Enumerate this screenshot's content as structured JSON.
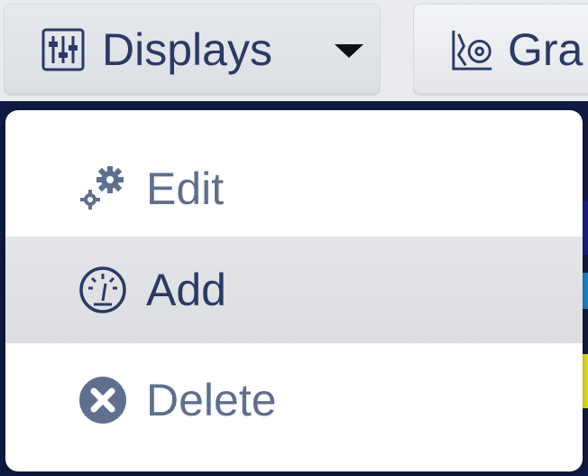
{
  "toolbar": {
    "displays_label": "Displays",
    "graphs_label": "Gra",
    "displays_icon": "sliders-icon",
    "graphs_icon": "graph-settings-icon"
  },
  "dropdown": {
    "items": [
      {
        "label": "Edit",
        "icon": "gears-icon"
      },
      {
        "label": "Add",
        "icon": "gauge-icon"
      },
      {
        "label": "Delete",
        "icon": "x-circle-icon"
      }
    ]
  },
  "colors": {
    "text_dark": "#2a3a66",
    "text_muted": "#5f6f8e",
    "hover_bg": "#e1e2e5",
    "page_bg_dark": "#0f1b44"
  }
}
